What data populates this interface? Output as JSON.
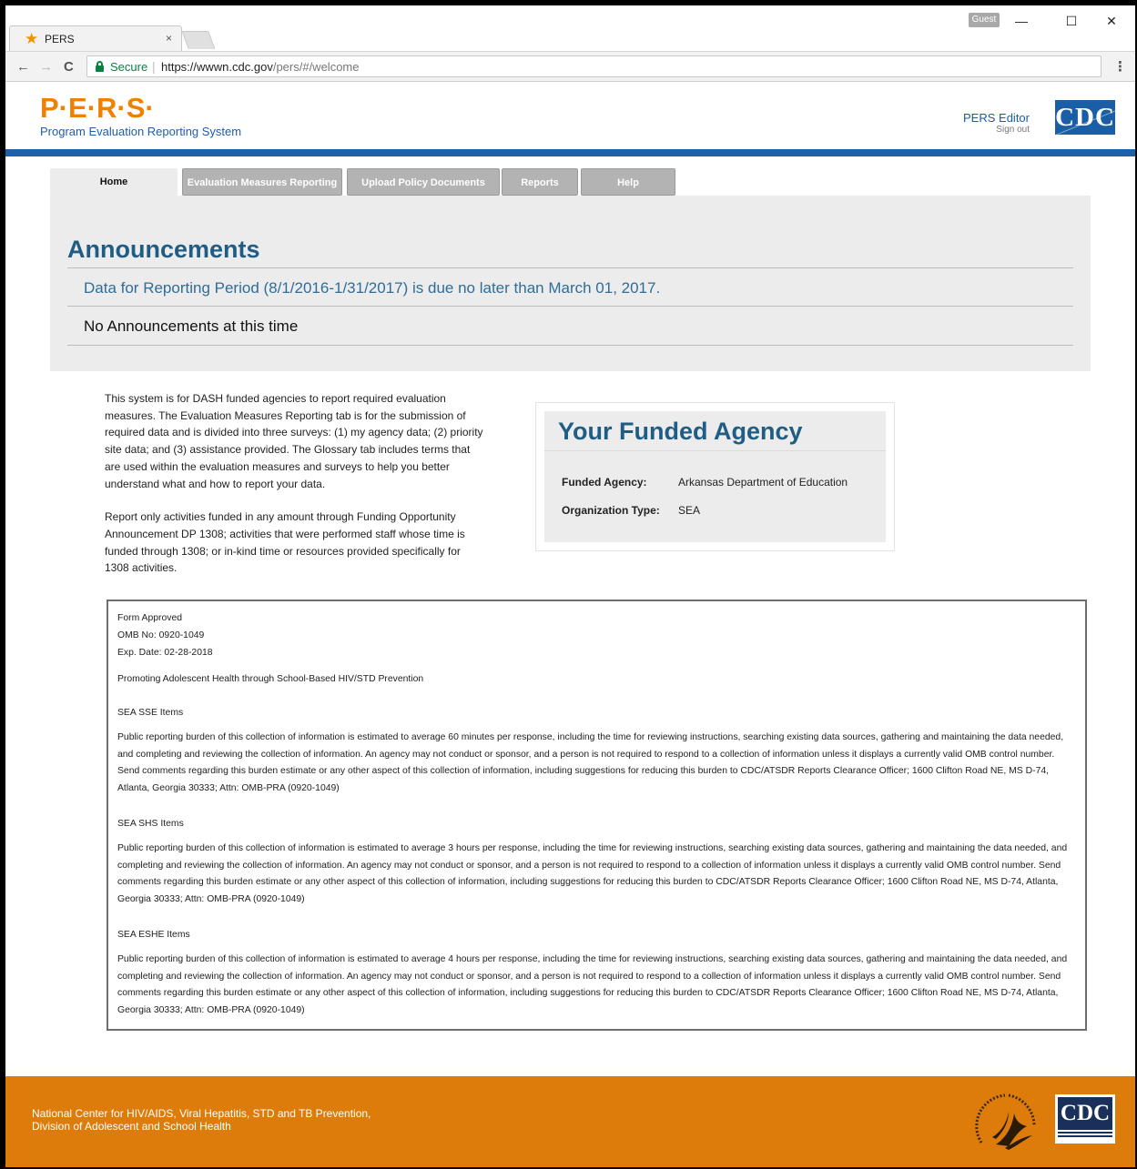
{
  "browser": {
    "tab_title": "PERS",
    "tab_close": "×",
    "guest_label": "Guest",
    "minimize": "—",
    "maximize": "☐",
    "close": "✕",
    "back": "←",
    "forward": "→",
    "reload": "C",
    "secure_label": "Secure",
    "url_separator": "|",
    "url_host": "https://wwwn.cdc.gov",
    "url_path": "/pers/#/welcome",
    "menu": "⋮"
  },
  "header": {
    "logo": "P·E·R·S·",
    "logo_subtitle": "Program Evaluation Reporting System",
    "user_name": "PERS Editor",
    "sign_out": "Sign out",
    "cdc_logo": "CDC"
  },
  "nav": {
    "tabs": [
      {
        "label": "Home",
        "active": true
      },
      {
        "label": "Evaluation Measures Reporting",
        "active": false
      },
      {
        "label": "Upload Policy Documents",
        "active": false
      },
      {
        "label": "Reports",
        "active": false
      },
      {
        "label": "Help",
        "active": false
      }
    ]
  },
  "announcements": {
    "title": "Announcements",
    "due_notice": "Data for Reporting Period (8/1/2016-1/31/2017) is due no later than March 01, 2017.",
    "none_text": "No Announcements at this time"
  },
  "intro": {
    "paragraph1": "This system is for DASH funded agencies to report required evaluation measures. The Evaluation Measures Reporting tab is for the submission of required data and is divided into three surveys: (1) my agency data; (2) priority site data; and (3) assistance provided. The Glossary tab includes terms that are used within the evaluation measures and surveys to help you better understand what and how to report your data.",
    "paragraph2": "Report only activities funded in any amount through Funding Opportunity Announcement DP 1308; activities that were performed staff whose time is funded through 1308; or in-kind time or resources provided specifically for 1308 activities."
  },
  "agency": {
    "title": "Your Funded Agency",
    "funded_agency_label": "Funded Agency:",
    "funded_agency_value": "Arkansas Department of Education",
    "org_type_label": "Organization Type:",
    "org_type_value": "SEA"
  },
  "omb": {
    "form_approved": "Form Approved",
    "omb_no": "OMB No: 0920-1049",
    "exp_date": "Exp. Date: 02-28-2018",
    "program": "Promoting Adolescent Health through School-Based HIV/STD Prevention",
    "sections": [
      {
        "heading": "SEA SSE Items",
        "text": "Public reporting burden of this collection of information is estimated to average 60 minutes per response, including the time for reviewing instructions, searching existing data sources, gathering and maintaining the data needed, and completing and reviewing the collection of information. An agency may not conduct or sponsor, and a person is not required to respond to a collection of information unless it displays a currently valid OMB control number. Send comments regarding this burden estimate or any other aspect of this collection of information, including suggestions for reducing this burden to CDC/ATSDR Reports Clearance Officer; 1600 Clifton Road NE, MS D-74, Atlanta, Georgia 30333; Attn: OMB-PRA (0920-1049)"
      },
      {
        "heading": "SEA SHS Items",
        "text": "Public reporting burden of this collection of information is estimated to average 3 hours per response, including the time for reviewing instructions, searching existing data sources, gathering and maintaining the data needed, and completing and reviewing the collection of information. An agency may not conduct or sponsor, and a person is not required to respond to a collection of information unless it displays a currently valid OMB control number. Send comments regarding this burden estimate or any other aspect of this collection of information, including suggestions for reducing this burden to CDC/ATSDR Reports Clearance Officer; 1600 Clifton Road NE, MS D-74, Atlanta, Georgia 30333; Attn: OMB-PRA (0920-1049)"
      },
      {
        "heading": "SEA ESHE Items",
        "text": "Public reporting burden of this collection of information is estimated to average 4 hours per response, including the time for reviewing instructions, searching existing data sources, gathering and maintaining the data needed, and completing and reviewing the collection of information. An agency may not conduct or sponsor, and a person is not required to respond to a collection of information unless it displays a currently valid OMB control number. Send comments regarding this burden estimate or any other aspect of this collection of information, including suggestions for reducing this burden to CDC/ATSDR Reports Clearance Officer; 1600 Clifton Road NE, MS D-74, Atlanta, Georgia 30333; Attn: OMB-PRA (0920-1049)"
      }
    ]
  },
  "footer": {
    "line1": "National Center for HIV/AIDS, Viral Hepatitis, STD and TB Prevention,",
    "line2": "Division of Adolescent and School Health",
    "cdc_logo": "CDC"
  },
  "colors": {
    "brand_orange": "#f08000",
    "brand_blue": "#1c60a9",
    "heading_blue": "#1f5d85",
    "footer_orange": "#dd7c0a"
  }
}
